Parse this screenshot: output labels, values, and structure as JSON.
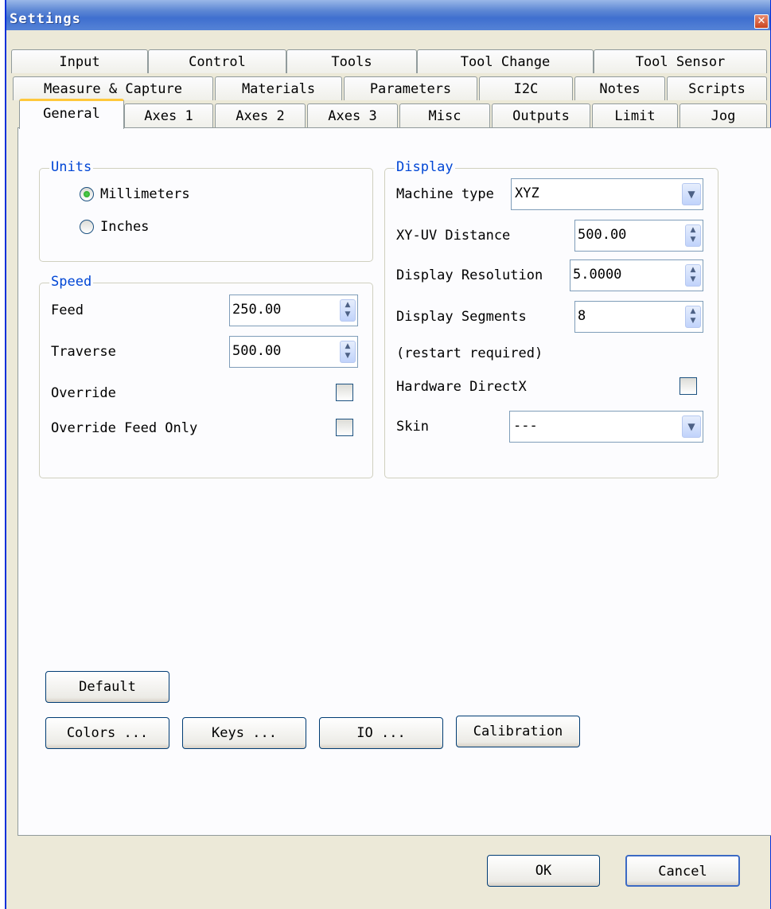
{
  "window": {
    "title": "Settings",
    "close_glyph": "✕"
  },
  "tabs": {
    "row1": [
      "Input",
      "Control",
      "Tools",
      "Tool Change",
      "Tool Sensor"
    ],
    "row2": [
      "Measure & Capture",
      "Materials",
      "Parameters",
      "I2C",
      "Notes",
      "Scripts"
    ],
    "row3": [
      "General",
      "Axes 1",
      "Axes 2",
      "Axes 3",
      "Misc",
      "Outputs",
      "Limit",
      "Jog"
    ],
    "active": "General"
  },
  "units": {
    "legend": "Units",
    "options": [
      "Millimeters",
      "Inches"
    ],
    "selected": "Millimeters"
  },
  "speed": {
    "legend": "Speed",
    "feed_label": "Feed",
    "feed_value": "250.00",
    "traverse_label": "Traverse",
    "traverse_value": "500.00",
    "override_label": "Override",
    "override_checked": false,
    "override_feed_only_label": "Override Feed Only",
    "override_feed_only_checked": false
  },
  "display": {
    "legend": "Display",
    "machine_type_label": "Machine type",
    "machine_type_value": "XYZ",
    "xyuv_label": "XY-UV Distance",
    "xyuv_value": "500.00",
    "resolution_label": "Display Resolution",
    "resolution_value": "5.0000",
    "segments_label": "Display Segments",
    "segments_value": "8",
    "restart_note": "(restart required)",
    "directx_label": "Hardware DirectX",
    "directx_checked": false,
    "skin_label": "Skin",
    "skin_value": "---"
  },
  "buttons": {
    "default": "Default",
    "colors": "Colors ...",
    "keys": "Keys ...",
    "io": "IO ...",
    "calibration": "Calibration",
    "ok": "OK",
    "cancel": "Cancel"
  },
  "icons": {
    "close": "close-icon",
    "spin": "spin-arrows-icon",
    "dropdown": "chevron-down-icon"
  },
  "colors": {
    "title_bar": "#3f6fcf",
    "group_legend": "#0046d5",
    "active_tab_accent": "#ffc83c",
    "dialog_bg": "#ece9d8"
  }
}
